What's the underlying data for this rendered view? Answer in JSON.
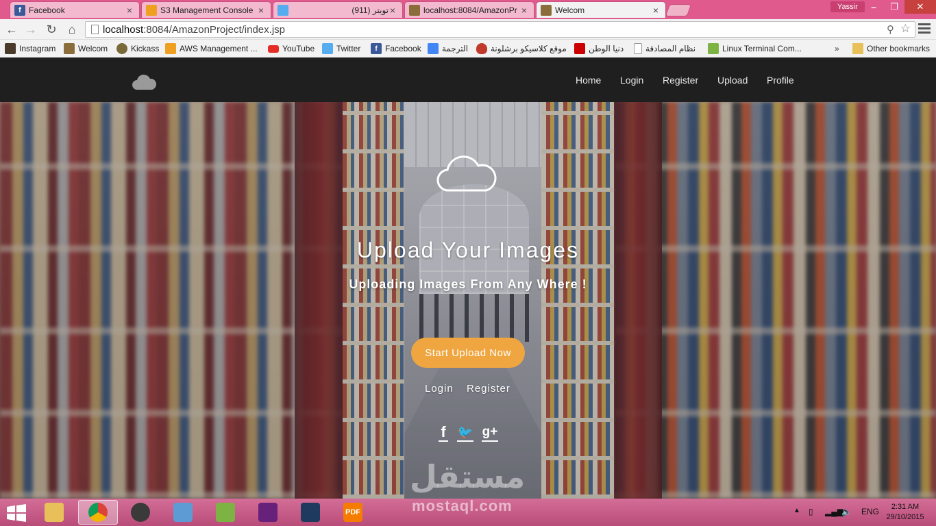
{
  "browser": {
    "tabs": [
      {
        "title": "Facebook",
        "favicon": "facebook-icon",
        "color": "#3b5998",
        "glyph": "f"
      },
      {
        "title": "S3 Management Console",
        "favicon": "aws-icon",
        "color": "#f0a020",
        "glyph": ""
      },
      {
        "title": "(911) تويتر",
        "favicon": "twitter-icon",
        "color": "#55acee",
        "glyph": ""
      },
      {
        "title": "localhost:8084/AmazonPr",
        "favicon": "image-icon",
        "color": "#8a6d3b",
        "glyph": ""
      },
      {
        "title": "Welcom",
        "favicon": "image-icon",
        "color": "#8a6d3b",
        "glyph": ""
      }
    ],
    "user": "Yassir",
    "url_host": "localhost",
    "url_rest": ":8084/AmazonProject/index.jsp"
  },
  "bookmarks": [
    {
      "label": "Instagram",
      "icon": "instagram-icon",
      "color": "#4a3a2a"
    },
    {
      "label": "Welcom",
      "icon": "image-icon",
      "color": "#8a6d3b"
    },
    {
      "label": "Kickass",
      "icon": "kickass-icon",
      "color": "#7a6a3a"
    },
    {
      "label": "AWS Management ...",
      "icon": "aws-icon",
      "color": "#f0a020"
    },
    {
      "label": "YouTube",
      "icon": "youtube-icon",
      "color": "#e52d27"
    },
    {
      "label": "Twitter",
      "icon": "twitter-icon",
      "color": "#55acee"
    },
    {
      "label": "Facebook",
      "icon": "facebook-icon",
      "color": "#3b5998"
    },
    {
      "label": "الترجمة",
      "icon": "translate-icon",
      "color": "#4285f4"
    },
    {
      "label": "موقع كلاسيكو برشلونة",
      "icon": "barca-icon",
      "color": "#c0392b"
    },
    {
      "label": "دنيا الوطن",
      "icon": "news-icon",
      "color": "#cc0000"
    },
    {
      "label": "نظام المصادقة",
      "icon": "page-icon",
      "color": "#ffffff"
    },
    {
      "label": "Linux Terminal Com...",
      "icon": "terminal-icon",
      "color": "#7cb342"
    }
  ],
  "bookmarks_more": "»",
  "other_bookmarks": "Other bookmarks",
  "site": {
    "nav": [
      "Home",
      "Login",
      "Register",
      "Upload",
      "Profile"
    ],
    "hero_title": "Upload Your Images",
    "hero_subtitle": "Uploading Images From Any Where !",
    "cta": "Start Upload Now",
    "links": [
      "Login",
      "Register"
    ],
    "social": [
      {
        "icon": "facebook-icon",
        "glyph": "f"
      },
      {
        "icon": "twitter-icon",
        "glyph": "🐦"
      },
      {
        "icon": "google-plus-icon",
        "glyph": "g+"
      }
    ],
    "watermark_ar": "مستقل",
    "watermark_en": "mostaql.com"
  },
  "taskbar": {
    "language": "ENG",
    "time": "2:31 AM",
    "date": "29/10/2015"
  }
}
